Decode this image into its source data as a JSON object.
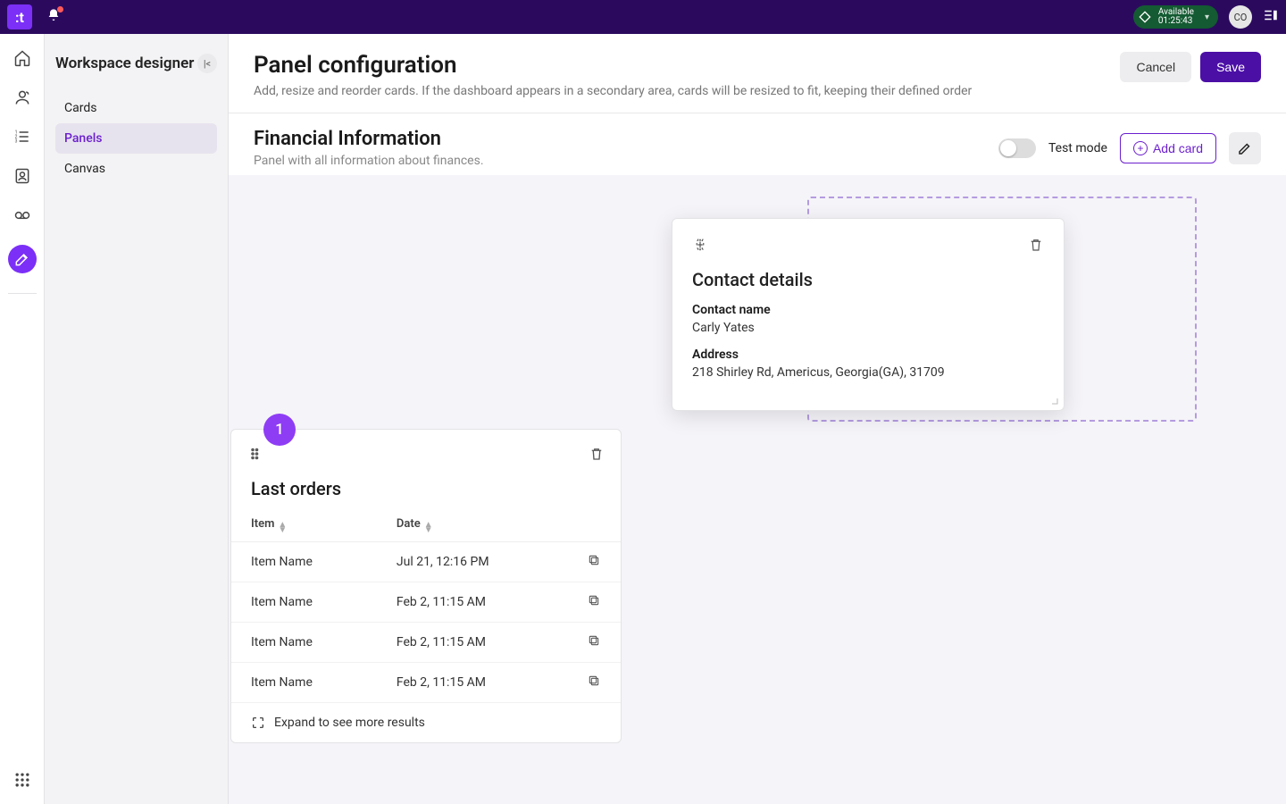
{
  "topbar": {
    "status_label": "Available",
    "status_time": "01:25:43",
    "avatar_initials": "CO"
  },
  "sidebar": {
    "title": "Workspace designer",
    "items": [
      {
        "label": "Cards"
      },
      {
        "label": "Panels"
      },
      {
        "label": "Canvas"
      }
    ]
  },
  "header": {
    "title": "Panel configuration",
    "subtitle": "Add, resize and reorder cards. If the dashboard appears in a secondary area, cards will be resized to fit, keeping their defined order",
    "cancel": "Cancel",
    "save": "Save"
  },
  "panel": {
    "title": "Financial Information",
    "description": "Panel with all information about finances.",
    "test_mode_label": "Test mode",
    "add_card_label": "Add card"
  },
  "contact_card": {
    "title": "Contact details",
    "name_label": "Contact name",
    "name_value": "Carly Yates",
    "address_label": "Address",
    "address_value": "218 Shirley Rd, Americus, Georgia(GA), 31709"
  },
  "orders_card": {
    "badge": "1",
    "title": "Last orders",
    "col_item": "Item",
    "col_date": "Date",
    "rows": [
      {
        "item": "Item Name",
        "date": "Jul 21, 12:16 PM"
      },
      {
        "item": "Item Name",
        "date": "Feb 2, 11:15 AM"
      },
      {
        "item": "Item Name",
        "date": "Feb 2, 11:15 AM"
      },
      {
        "item": "Item Name",
        "date": "Feb 2, 11:15 AM"
      }
    ],
    "expand": "Expand to see more results"
  }
}
